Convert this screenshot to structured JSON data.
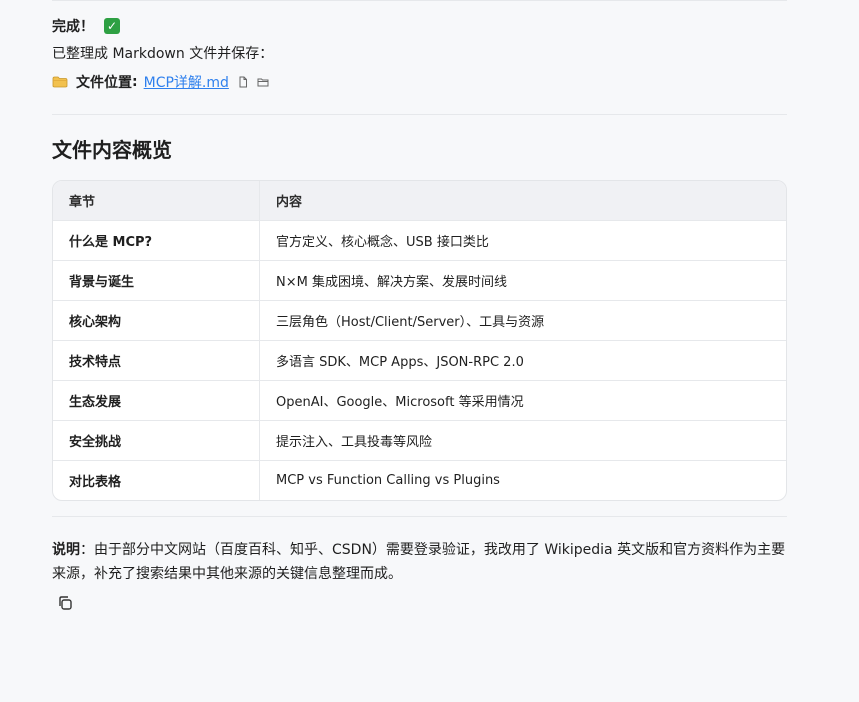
{
  "status": {
    "title": "完成！",
    "check_icon": "check-mark-icon"
  },
  "saved_text": "已整理成 Markdown 文件并保存：",
  "file": {
    "label": "文件位置",
    "colon": ":",
    "link_text": "MCP详解.md",
    "icons": [
      "folder-icon",
      "file-icon",
      "folder-open-icon"
    ]
  },
  "section_title": "文件内容概览",
  "table": {
    "headers": [
      "章节",
      "内容"
    ],
    "rows": [
      [
        "什么是 MCP?",
        "官方定义、核心概念、USB 接口类比"
      ],
      [
        "背景与诞生",
        "N×M 集成困境、解决方案、发展时间线"
      ],
      [
        "核心架构",
        "三层角色（Host/Client/Server）、工具与资源"
      ],
      [
        "技术特点",
        "多语言 SDK、MCP Apps、JSON-RPC 2.0"
      ],
      [
        "生态发展",
        "OpenAI、Google、Microsoft 等采用情况"
      ],
      [
        "安全挑战",
        "提示注入、工具投毒等风险"
      ],
      [
        "对比表格",
        "MCP vs Function Calling vs Plugins"
      ]
    ]
  },
  "note": {
    "label": "说明",
    "text": "：由于部分中文网站（百度百科、知乎、CSDN）需要登录验证，我改用了 Wikipedia 英文版和官方资料作为主要来源，补充了搜索结果中其他来源的关键信息整理而成。"
  },
  "copy_icon": "copy-icon",
  "colors": {
    "link": "#2f80ed",
    "check_bg": "#2ea043"
  }
}
